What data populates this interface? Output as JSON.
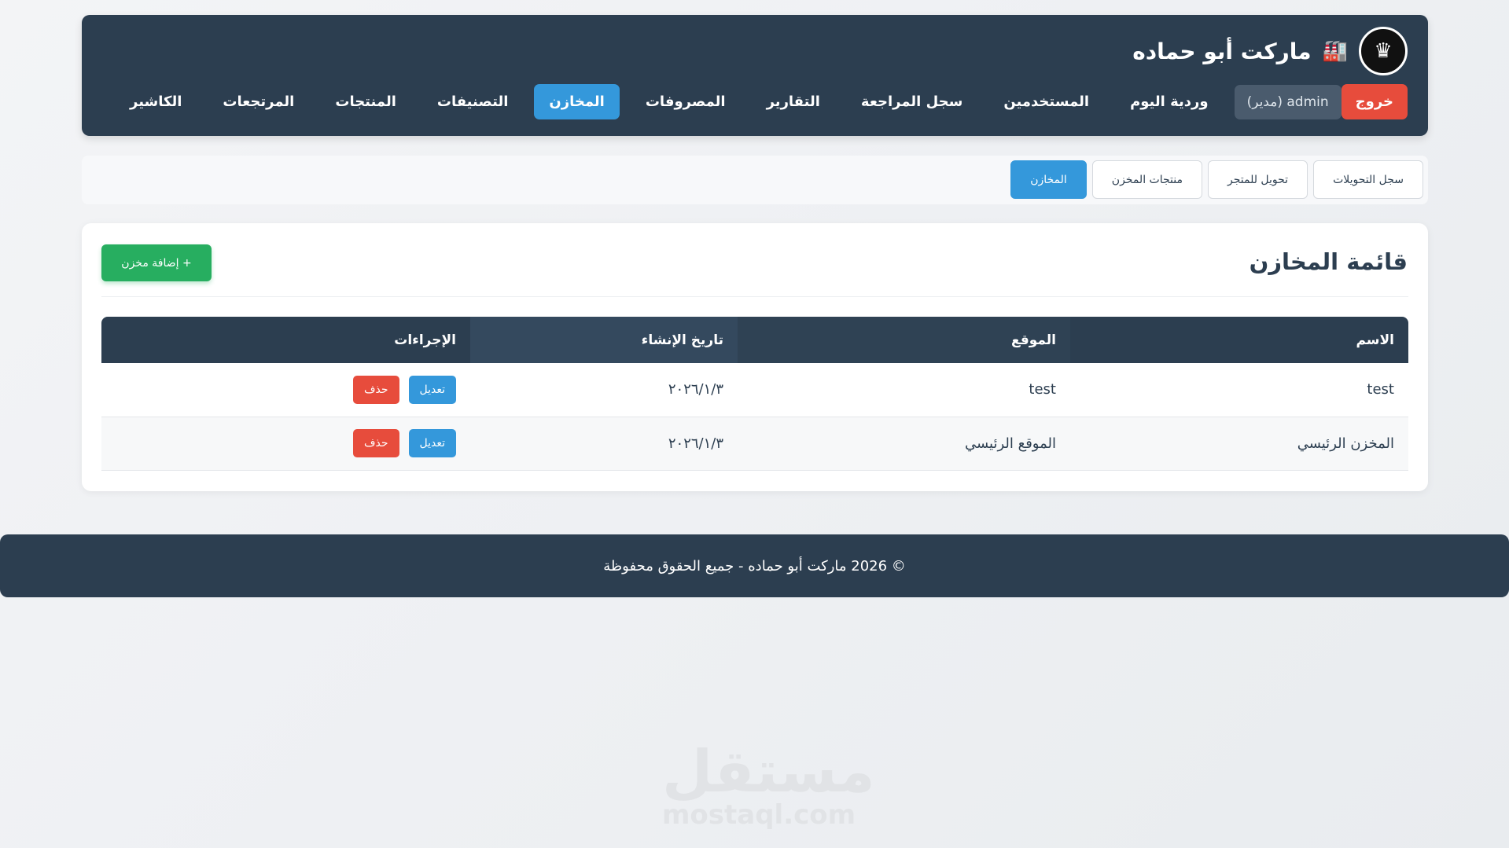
{
  "header": {
    "title": "ماركت أبو حماده",
    "logo_icon": "crown-logo-icon",
    "title_icon": "factory-icon"
  },
  "nav": {
    "items": [
      {
        "label": "الكاشير"
      },
      {
        "label": "المرتجعات"
      },
      {
        "label": "المنتجات"
      },
      {
        "label": "التصنيفات"
      },
      {
        "label": "المخازن"
      },
      {
        "label": "المصروفات"
      },
      {
        "label": "التقارير"
      },
      {
        "label": "سجل المراجعة"
      },
      {
        "label": "المستخدمين"
      },
      {
        "label": "وردية اليوم"
      }
    ],
    "active": "المخازن",
    "user_label": "admin (مدير)",
    "logout_label": "خروج"
  },
  "subnav": {
    "tabs": [
      {
        "label": "المخازن"
      },
      {
        "label": "منتجات المخزن"
      },
      {
        "label": "تحويل للمتجر"
      },
      {
        "label": "سجل التحويلات"
      }
    ],
    "active": "المخازن"
  },
  "card": {
    "title": "قائمة المخازن",
    "add_button": "+ إضافة مخزن"
  },
  "table": {
    "headers": [
      "الاسم",
      "الموقع",
      "تاريخ الإنشاء",
      "الإجراءات"
    ],
    "rows": [
      {
        "name": "test",
        "location": "test",
        "created": "٢٠٢٦/١/٣",
        "edit": "تعديل",
        "delete": "حذف"
      },
      {
        "name": "المخزن الرئيسي",
        "location": "الموقع الرئيسي",
        "created": "٢٠٢٦/١/٣",
        "edit": "تعديل",
        "delete": "حذف"
      }
    ]
  },
  "footer": {
    "text": "© 2026 ماركت أبو حماده - جميع الحقوق محفوظة"
  },
  "watermark": {
    "arabic": "مستقل",
    "english": "mostaql.com"
  },
  "colors": {
    "navy": "#2c3e50",
    "blue": "#3498db",
    "green": "#27ae60",
    "red": "#e74c3c"
  }
}
